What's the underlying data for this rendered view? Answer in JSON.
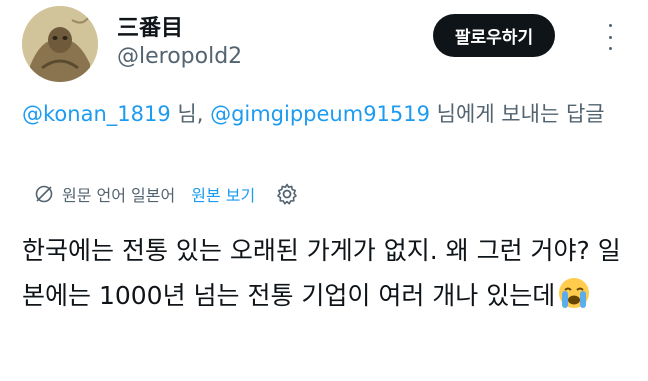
{
  "author": {
    "display_name": "三番目",
    "handle": "@leropold2"
  },
  "follow_button_label": "팔로우하기",
  "reply_context": {
    "mention_1": "@konan_1819",
    "sep_1": " 님, ",
    "mention_2": "@gimgippeum91519",
    "suffix": " 님에게 보내는 답글"
  },
  "translation": {
    "icon": "globe-slash-icon",
    "label": "원문 언어 일본어",
    "view_original": "원본 보기",
    "settings_icon": "gear-icon"
  },
  "tweet": {
    "text": "한국에는 전통 있는 오래된 가게가 없지. 왜 그런 거야? 일본에는 1000년 넘는 전통 기업이 여러 개나 있는데",
    "emoji": "loudly-crying-face-emoji"
  },
  "colors": {
    "link": "#1d9bf0",
    "secondary_text": "#536471",
    "button_bg": "#0f1419"
  }
}
